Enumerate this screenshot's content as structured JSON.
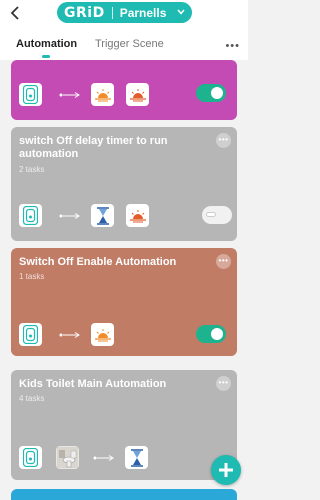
{
  "header": {
    "logo_text": "GRiD",
    "home_name": "Parnells"
  },
  "tabs": [
    {
      "label": "Automation",
      "active": true
    },
    {
      "label": "Trigger Scene",
      "active": false
    }
  ],
  "tabs_more": "•••",
  "cards": [
    {
      "title": "",
      "subtitle": "",
      "color": "#c44bb4",
      "enabled": true,
      "actions": [
        "sunrise-icon",
        "sunset-icon"
      ]
    },
    {
      "title": "switch Off delay timer to run automation",
      "subtitle": "2 tasks",
      "color": "#b6b6b6",
      "enabled": false,
      "actions": [
        "hourglass-icon",
        "sunset-icon"
      ]
    },
    {
      "title": "Switch Off Enable Automation",
      "subtitle": "1 tasks",
      "color": "#c17c66",
      "enabled": true,
      "actions": [
        "sunrise-icon"
      ]
    },
    {
      "title": "Kids Toilet Main Automation",
      "subtitle": "4 tasks",
      "color": "#b6b6b6",
      "enabled": false,
      "actions": [
        "hourglass-icon"
      ]
    }
  ],
  "card_more": "•••",
  "colors": {
    "accent": "#1fbab1",
    "toggle_on": "#1db38f"
  }
}
